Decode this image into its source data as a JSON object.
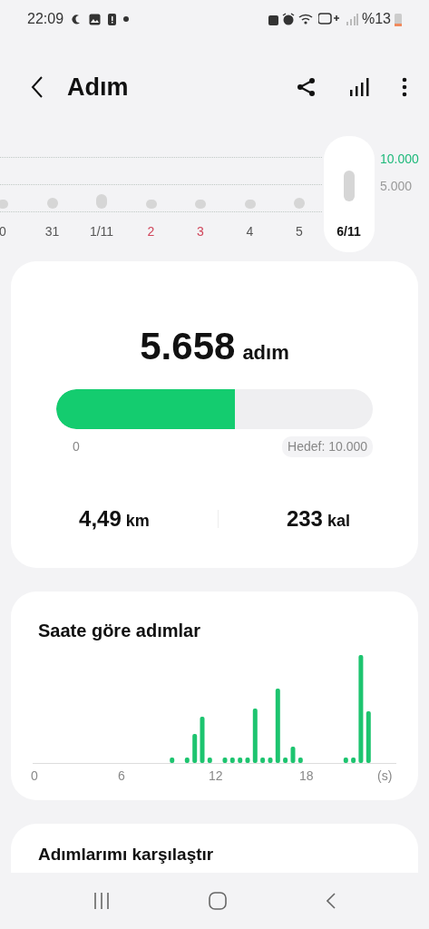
{
  "status_bar": {
    "time": "22:09",
    "battery": "%13"
  },
  "app_bar": {
    "title": "Adım"
  },
  "week_strip": {
    "goal_lines": [
      {
        "label": "10.000",
        "color": "#1db97a"
      },
      {
        "label": "5.000",
        "color": "#9a9a9a"
      }
    ],
    "days": [
      {
        "label": "0",
        "color": "#555555",
        "selected": false
      },
      {
        "label": "31",
        "color": "#555555",
        "selected": false
      },
      {
        "label": "1/11",
        "color": "#555555",
        "selected": false
      },
      {
        "label": "2",
        "color": "#d0455a",
        "selected": false
      },
      {
        "label": "3",
        "color": "#d0455a",
        "selected": false
      },
      {
        "label": "4",
        "color": "#555555",
        "selected": false
      },
      {
        "label": "5",
        "color": "#555555",
        "selected": false
      },
      {
        "label": "6/11",
        "color": "#111111",
        "selected": true
      }
    ]
  },
  "summary": {
    "steps": "5.658",
    "steps_unit": "adım",
    "progress": {
      "level": 0.5658,
      "min_label": "0",
      "goal_label": "Hedef: 10.000"
    },
    "stats": [
      {
        "value": "4,49",
        "unit": "km"
      },
      {
        "value": "233",
        "unit": "kal"
      }
    ]
  },
  "hourly": {
    "title": "Saate göre adımlar",
    "axis_labels": [
      "0",
      "6",
      "12",
      "18",
      "(s)"
    ]
  },
  "compare": {
    "title": "Adımlarımı karşılaştır"
  }
}
